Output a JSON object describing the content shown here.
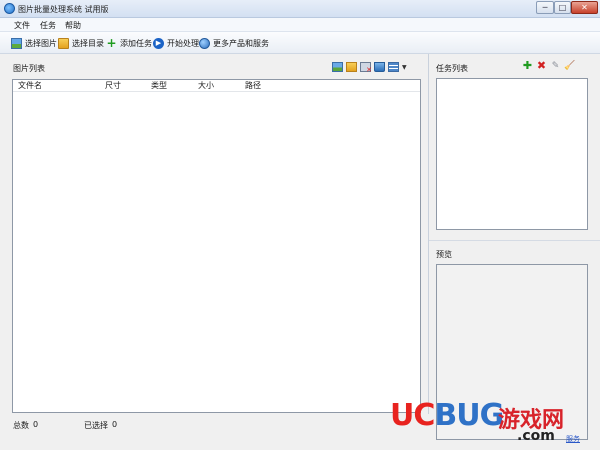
{
  "window": {
    "title": "图片批量处理系统 试用版",
    "controls": {
      "minimize": "─",
      "maximize": "□",
      "close": "✕"
    }
  },
  "menu": [
    "文件",
    "任务",
    "帮助"
  ],
  "toolbar": {
    "select_image": "选择图片",
    "select_folder": "选择目录",
    "add_task": "添加任务",
    "start": "开始处理",
    "more_products": "更多产品和服务"
  },
  "image_list": {
    "title": "图片列表",
    "columns": [
      "文件名",
      "尺寸",
      "类型",
      "大小",
      "路径"
    ],
    "rows": []
  },
  "task_list": {
    "title": "任务列表"
  },
  "preview": {
    "title": "预览"
  },
  "status": {
    "total_label": "总数",
    "total_value": "0",
    "selected_label": "已选择",
    "selected_value": "0"
  },
  "watermark": {
    "brand_u": "U",
    "brand_c": "C",
    "brand_bug": "BUG",
    "brand_cn": "游戏网",
    "brand_com": ".com",
    "link": "服务"
  },
  "colors": {
    "accent": "#1b63c6",
    "close_button": "#c7412b",
    "add_green": "#1f9b1f",
    "delete_red": "#d22222"
  }
}
